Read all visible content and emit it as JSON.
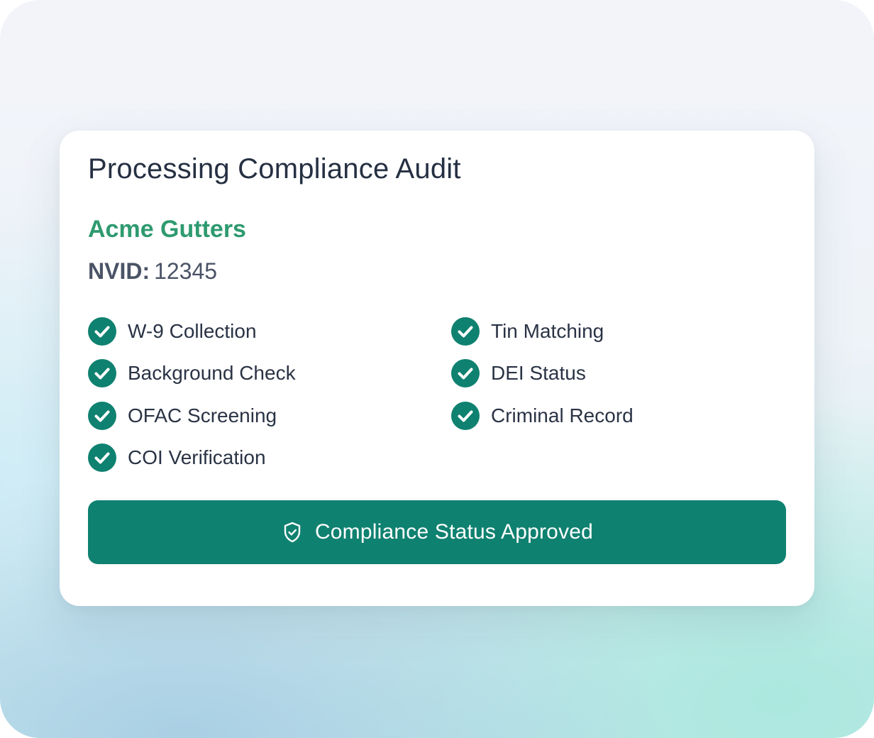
{
  "card": {
    "title": "Processing Compliance Audit",
    "company_name": "Acme Gutters",
    "nvid_label": "NVID:",
    "nvid_value": "12345"
  },
  "checks": {
    "left": [
      {
        "label": "W-9 Collection",
        "status": "complete",
        "icon": "check-circle-icon"
      },
      {
        "label": "Background Check",
        "status": "complete",
        "icon": "check-circle-icon"
      },
      {
        "label": "OFAC Screening",
        "status": "complete",
        "icon": "check-circle-icon"
      },
      {
        "label": "COI Verification",
        "status": "complete",
        "icon": "check-circle-icon"
      }
    ],
    "right": [
      {
        "label": "Tin Matching",
        "status": "complete",
        "icon": "check-circle-icon"
      },
      {
        "label": "DEI Status",
        "status": "complete",
        "icon": "check-circle-icon"
      },
      {
        "label": "Criminal Record",
        "status": "complete",
        "icon": "check-circle-icon"
      }
    ]
  },
  "status_button": {
    "label": "Compliance Status Approved",
    "icon": "shield-check-icon"
  },
  "colors": {
    "accent": "#0f8170",
    "company_text": "#2e9a70",
    "title_text": "#263043"
  }
}
